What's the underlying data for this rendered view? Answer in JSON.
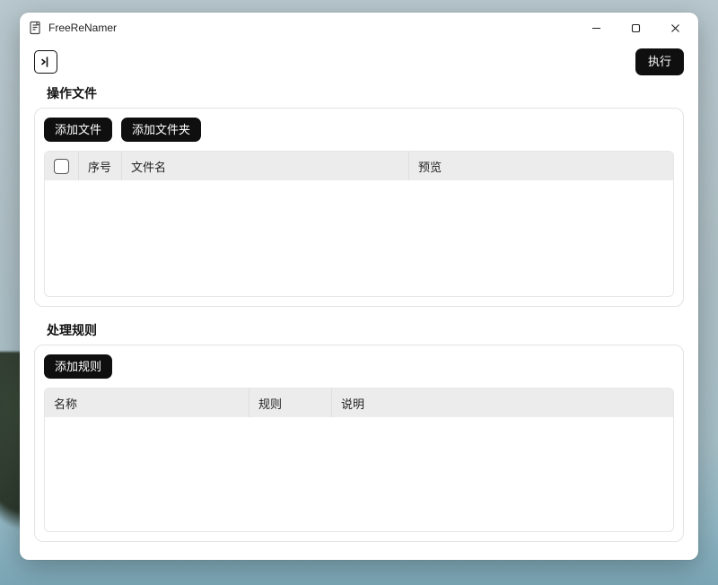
{
  "window": {
    "title": "FreeReNamer"
  },
  "toolbar": {
    "execute_label": "执行"
  },
  "files": {
    "section_title": "操作文件",
    "add_file_label": "添加文件",
    "add_folder_label": "添加文件夹",
    "columns": {
      "index": "序号",
      "filename": "文件名",
      "preview": "预览"
    },
    "rows": []
  },
  "rules": {
    "section_title": "处理规则",
    "add_rule_label": "添加规则",
    "columns": {
      "name": "名称",
      "rule": "规则",
      "description": "说明"
    },
    "rows": []
  }
}
